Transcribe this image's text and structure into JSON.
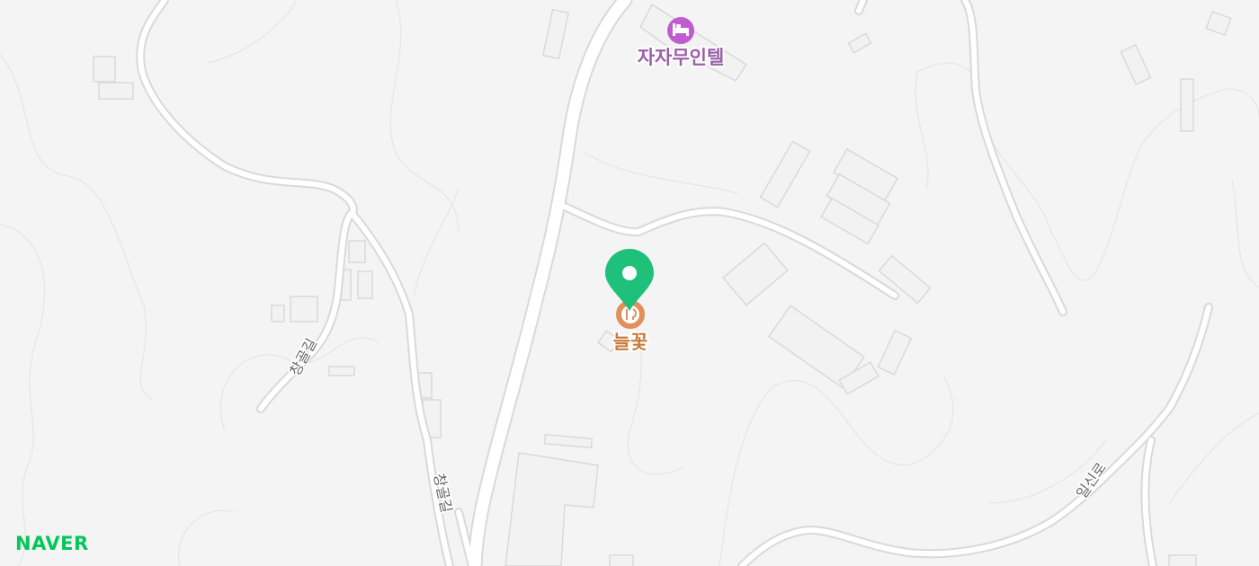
{
  "brand": {
    "name": "NAVER",
    "color": "#03c75a"
  },
  "labels": {
    "motel": "자자무인텔",
    "restaurant": "늘꽃",
    "road_left": "창골길",
    "road_center": "창골길",
    "road_right": "일신로"
  },
  "colors": {
    "background": "#f4f4f4",
    "road": "#ffffff",
    "road_outline": "#d9d9d9",
    "building": "#f2f2f2",
    "motel_label": "#9b5fa8",
    "motel_icon": "#c05ccf",
    "restaurant_label": "#c97b3a",
    "restaurant_icon": "#e0905a",
    "pin": "#1ec07a"
  },
  "icons": {
    "motel": "bed-icon",
    "restaurant": "restaurant-icon",
    "pin": "location-pin-icon"
  }
}
